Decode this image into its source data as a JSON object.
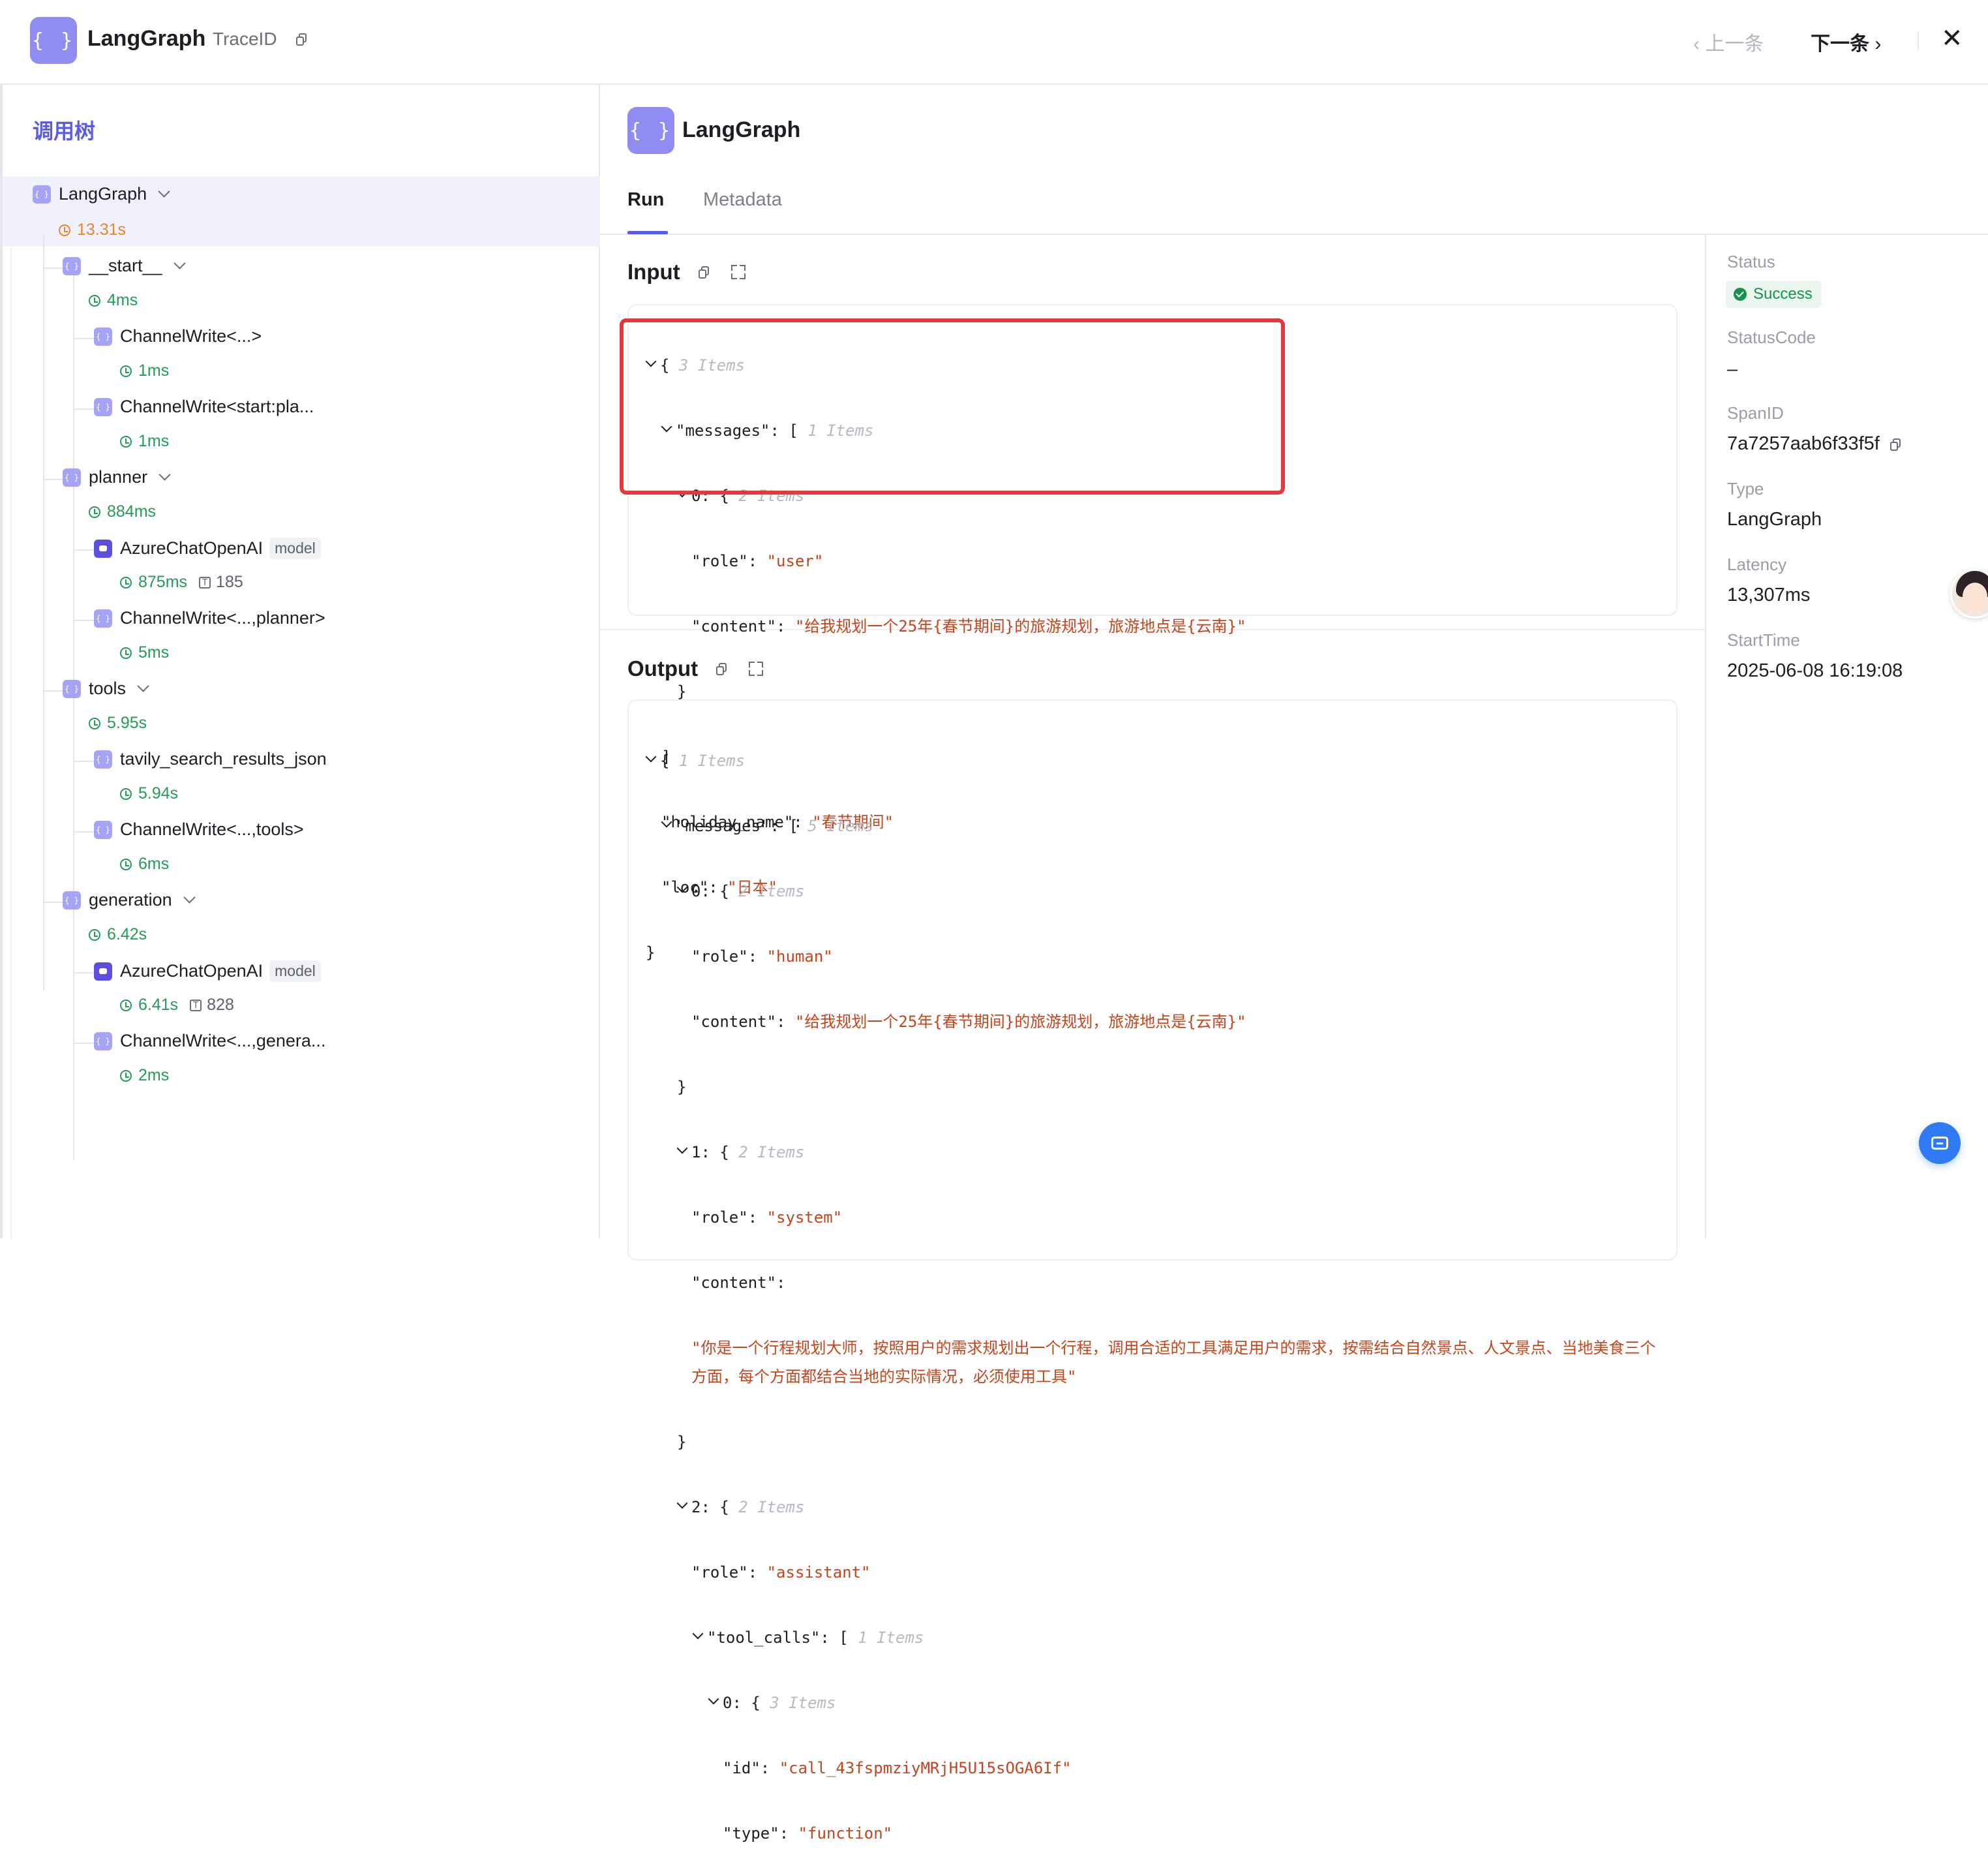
{
  "header": {
    "logo_glyph": "{ }",
    "title": "LangGraph",
    "trace_label": "TraceID",
    "prev_label": "上一条",
    "next_label": "下一条",
    "close_glyph": "✕"
  },
  "tree": {
    "title": "调用树",
    "nodes": [
      {
        "label": "LangGraph",
        "time": "13.31s"
      },
      {
        "label": "__start__",
        "time": "4ms"
      },
      {
        "label": "ChannelWrite<...>",
        "time": "1ms"
      },
      {
        "label": "ChannelWrite<start:pla...",
        "time": "1ms"
      },
      {
        "label": "planner",
        "time": "884ms"
      },
      {
        "label": "AzureChatOpenAI",
        "tag": "model",
        "time": "875ms",
        "tokens": "185"
      },
      {
        "label": "ChannelWrite<...,planner>",
        "time": "5ms"
      },
      {
        "label": "tools",
        "time": "5.95s"
      },
      {
        "label": "tavily_search_results_json",
        "time": "5.94s"
      },
      {
        "label": "ChannelWrite<...,tools>",
        "time": "6ms"
      },
      {
        "label": "generation",
        "time": "6.42s"
      },
      {
        "label": "AzureChatOpenAI",
        "tag": "model",
        "time": "6.41s",
        "tokens": "828"
      },
      {
        "label": "ChannelWrite<...,genera...",
        "time": "2ms"
      }
    ],
    "token_glyph": "T"
  },
  "detail": {
    "icon_glyph": "{ }",
    "title": "LangGraph",
    "tabs": [
      "Run",
      "Metadata"
    ],
    "input_title": "Input",
    "output_title": "Output"
  },
  "input_json": {
    "l0_brace": "{",
    "l0_meta": "3 Items",
    "l1_key": "\"messages\"",
    "l1_open": ": [",
    "l1_meta": "1 Items",
    "l2_key": "0",
    "l2_open": ": {",
    "l2_meta": "2 Items",
    "l3_key": "\"role\"",
    "l3_val": "\"user\"",
    "l4_key": "\"content\"",
    "l4_val": "\"给我规划一个25年{春节期间}的旅游规划，旅游地点是{云南}\"",
    "l5": "}",
    "l6": "]",
    "l7_key": "\"holiday_name\"",
    "l7_val": "\"春节期间\"",
    "l8_key": "\"loc\"",
    "l8_val": "\"日本\"",
    "l9": "}"
  },
  "output_json": {
    "l0_brace": "{",
    "l0_meta": "1 Items",
    "l1_key": "\"messages\"",
    "l1_open": ": [",
    "l1_meta": "5 Items",
    "l2_key": "0",
    "l2_open": ": {",
    "l2_meta": "2 Items",
    "l3_key": "\"role\"",
    "l3_val": "\"human\"",
    "l4_key": "\"content\"",
    "l4_val": "\"给我规划一个25年{春节期间}的旅游规划，旅游地点是{云南}\"",
    "l5": "}",
    "l6_key": "1",
    "l6_open": ": {",
    "l6_meta": "2 Items",
    "l7_key": "\"role\"",
    "l7_val": "\"system\"",
    "l8_key": "\"content\"",
    "l8_colon": ":",
    "l9_val": "\"你是一个行程规划大师，按照用户的需求规划出一个行程，调用合适的工具满足用户的需求，按需结合自然景点、人文景点、当地美食三个方面，每个方面都结合当地的实际情况，必须使用工具\"",
    "l10": "}",
    "l11_key": "2",
    "l11_open": ": {",
    "l11_meta": "2 Items",
    "l12_key": "\"role\"",
    "l12_val": "\"assistant\"",
    "l13_key": "\"tool_calls\"",
    "l13_open": ": [",
    "l13_meta": "1 Items",
    "l14_key": "0",
    "l14_open": ": {",
    "l14_meta": "3 Items",
    "l15_key": "\"id\"",
    "l15_val": "\"call_43fspmziyMRjH5U15sOGA6If\"",
    "l16_key": "\"type\"",
    "l16_val": "\"function\""
  },
  "meta": {
    "status_label": "Status",
    "status_value": "Success",
    "status_code_label": "StatusCode",
    "status_code_value": "–",
    "span_label": "SpanID",
    "span_value": "7a7257aab6f33f5f",
    "type_label": "Type",
    "type_value": "LangGraph",
    "latency_label": "Latency",
    "latency_value": "13,307ms",
    "start_label": "StartTime",
    "start_value": "2025-06-08 16:19:08"
  },
  "colors": {
    "accent": "#5b5ce6",
    "node_icon": "#a6a4f5",
    "model_icon": "#5b4fe0",
    "time_green": "#1f9d55",
    "time_orange": "#e8862a",
    "json_string": "#c4451c",
    "highlight_box": "#e03a3a",
    "success": "#16924a"
  }
}
